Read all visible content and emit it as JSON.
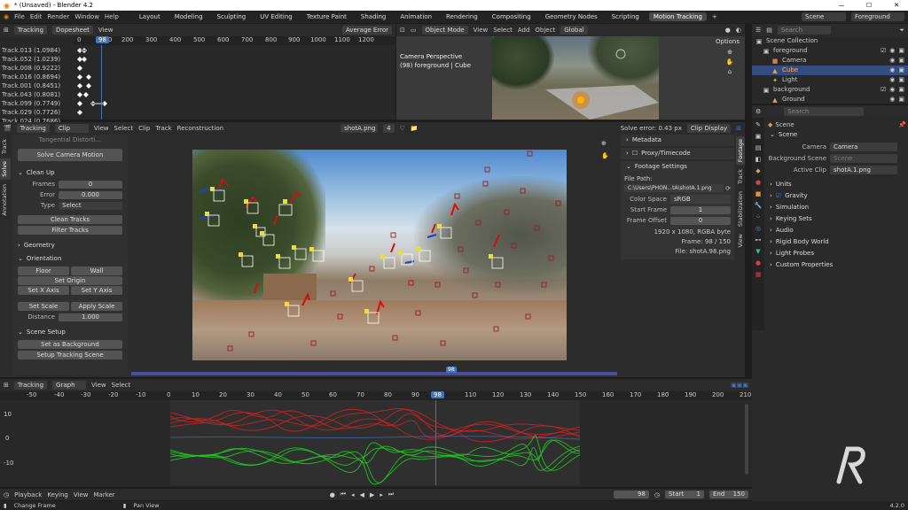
{
  "titlebar": {
    "title": "* (Unsaved) - Blender 4.2"
  },
  "menu": [
    "File",
    "Edit",
    "Render",
    "Window",
    "Help"
  ],
  "workspaces": [
    "Layout",
    "Modeling",
    "Sculpting",
    "UV Editing",
    "Texture Paint",
    "Shading",
    "Animation",
    "Rendering",
    "Compositing",
    "Geometry Nodes",
    "Scripting",
    "Motion Tracking"
  ],
  "active_workspace": "Motion Tracking",
  "top_right": {
    "scene": "Scene",
    "view_layer": "Foreground"
  },
  "dopesheet": {
    "editor": "Tracking",
    "mode": "Dopesheet",
    "view": "View",
    "sort": "Average Error",
    "current_frame": "98",
    "ruler": [
      "0",
      "100",
      "200",
      "300",
      "400",
      "500",
      "600",
      "700",
      "800",
      "900",
      "1000",
      "1100",
      "1200"
    ],
    "tracks": [
      "Track.013 (1.0984)",
      "Track.052 (1.0239)",
      "Track.008 (0.9222)",
      "Track.016 (0.8694)",
      "Track.001 (0.8451)",
      "Track.043 (0.8081)",
      "Track.099 (0.7749)",
      "Track.029 (0.7726)",
      "Track.024 (0.7686)"
    ]
  },
  "viewport3d": {
    "mode": "Object Mode",
    "menus": [
      "View",
      "Select",
      "Add",
      "Object"
    ],
    "orientation": "Global",
    "options": "Options",
    "info_line1": "Camera Perspective",
    "info_line2": "(98) foreground | Cube"
  },
  "outliner": {
    "search_placeholder": "Search",
    "items": [
      {
        "label": "Scene Collection",
        "indent": 0,
        "icon": "collection",
        "selected": false
      },
      {
        "label": "foreground",
        "indent": 1,
        "icon": "collection",
        "selected": false
      },
      {
        "label": "Camera",
        "indent": 2,
        "icon": "camera",
        "selected": false
      },
      {
        "label": "Cube",
        "indent": 2,
        "icon": "mesh",
        "selected": true
      },
      {
        "label": "Light",
        "indent": 2,
        "icon": "light",
        "selected": false
      },
      {
        "label": "background",
        "indent": 1,
        "icon": "collection",
        "selected": false
      },
      {
        "label": "Ground",
        "indent": 2,
        "icon": "mesh",
        "selected": false
      }
    ]
  },
  "properties": {
    "search_placeholder": "Search",
    "breadcrumb": "Scene",
    "scene_panel": "Scene",
    "camera_label": "Camera",
    "camera_value": "Camera",
    "bg_scene_label": "Background Scene",
    "bg_scene_placeholder": "Scene",
    "active_clip_label": "Active Clip",
    "active_clip_value": "shotA.1.png",
    "panels": [
      "Units",
      "Gravity",
      "Simulation",
      "Keying Sets",
      "Audio",
      "Rigid Body World",
      "Light Probes",
      "Custom Properties"
    ]
  },
  "clip_editor": {
    "editor": "Tracking",
    "mode": "Clip",
    "menus": [
      "View",
      "Select",
      "Clip",
      "Track",
      "Reconstruction"
    ],
    "clip_name": "shotA.png",
    "users": "4",
    "solve_error": "Solve error: 0.43 px",
    "display": "Clip Display",
    "frame_badge": "98"
  },
  "tool_panel": {
    "tangential": "Tangential Distorti...",
    "solve_button": "Solve Camera Motion",
    "cleanup_title": "Clean Up",
    "frames_label": "Frames",
    "frames_value": "0",
    "error_label": "Error",
    "error_value": "0.000",
    "type_label": "Type",
    "type_value": "Select",
    "clean_tracks": "Clean Tracks",
    "filter_tracks": "Filter Tracks",
    "geometry_title": "Geometry",
    "orientation_title": "Orientation",
    "floor": "Floor",
    "wall": "Wall",
    "set_origin": "Set Origin",
    "set_x": "Set X Axis",
    "set_y": "Set Y Axis",
    "set_scale": "Set Scale",
    "apply_scale": "Apply Scale",
    "distance_label": "Distance",
    "distance_value": "1.000",
    "scene_setup_title": "Scene Setup",
    "set_background": "Set as Background",
    "setup_tracking_scene": "Setup Tracking Scene",
    "vtabs": [
      "Track",
      "Solve",
      "Annotation"
    ]
  },
  "footage": {
    "metadata": "Metadata",
    "proxy": "Proxy/Timecode",
    "settings": "Footage Settings",
    "file_path_label": "File Path:",
    "file_path": "C:\\Users\\PHON...tA\\shotA.1.png",
    "color_space_label": "Color Space",
    "color_space": "sRGB",
    "start_frame_label": "Start Frame",
    "start_frame": "1",
    "frame_offset_label": "Frame Offset",
    "frame_offset": "0",
    "info1": "1920 x 1080, RGBA byte",
    "info2": "Frame: 98 / 150",
    "info3": "File: shotA.98.png",
    "vtabs": [
      "Footage",
      "Track",
      "Stabilization",
      "View"
    ]
  },
  "graph": {
    "editor": "Tracking",
    "mode": "Graph",
    "menus": [
      "View",
      "Select"
    ],
    "ruler": [
      "-50",
      "-40",
      "-30",
      "-20",
      "-10",
      "0",
      "10",
      "20",
      "30",
      "40",
      "50",
      "60",
      "70",
      "80",
      "90",
      "98",
      "110",
      "120",
      "130",
      "140",
      "150",
      "160",
      "170",
      "180",
      "190",
      "200",
      "210"
    ],
    "yticks": [
      "10",
      "0",
      "-10"
    ]
  },
  "timeline": {
    "menus": [
      "Playback",
      "Keying",
      "View",
      "Marker"
    ],
    "frame": "98",
    "start_label": "Start",
    "start": "1",
    "end_label": "End",
    "end": "150"
  },
  "statusbar": {
    "left": "Change Frame",
    "mid": "Pan View",
    "version": "4.2.0"
  },
  "colors": {
    "accent": "#4772b3",
    "selected_row": "#334d80",
    "track_yellow": "#f5e400",
    "track_red": "#d01010",
    "track_green": "#20d020"
  }
}
